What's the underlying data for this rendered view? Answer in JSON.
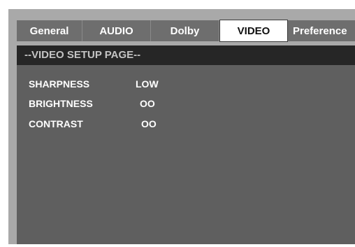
{
  "tabs": [
    {
      "label": "General",
      "active": false
    },
    {
      "label": "AUDIO",
      "active": false
    },
    {
      "label": "Dolby",
      "active": false
    },
    {
      "label": "VIDEO",
      "active": true
    },
    {
      "label": "Preference",
      "active": false
    }
  ],
  "page_title": "--VIDEO SETUP PAGE--",
  "settings": [
    {
      "label": "SHARPNESS",
      "value": "LOW"
    },
    {
      "label": "BRIGHTNESS",
      "value": "OO"
    },
    {
      "label": "CONTRAST",
      "value": "OO"
    }
  ],
  "colors": {
    "frame": "#a9a9a9",
    "tab_inactive": "#6e6e6e",
    "tab_active": "#ffffff",
    "header_bar": "#262626",
    "content_bg": "#5f5f5f"
  }
}
